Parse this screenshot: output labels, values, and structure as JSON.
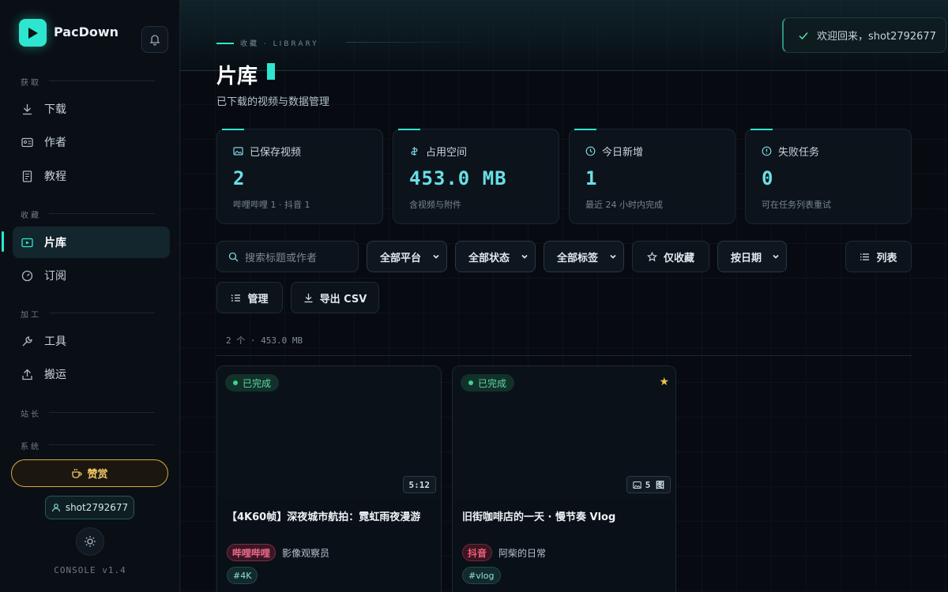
{
  "app": {
    "name": "PacDown",
    "version": "CONSOLE v1.4"
  },
  "sidebar": {
    "sections": [
      {
        "label": "获取"
      },
      {
        "label": "收藏"
      },
      {
        "label": "加工"
      },
      {
        "label": "站长"
      },
      {
        "label": "系统"
      }
    ],
    "items": [
      {
        "label": "下载",
        "icon": "download-icon"
      },
      {
        "label": "作者",
        "icon": "id-card-icon"
      },
      {
        "label": "教程",
        "icon": "book-icon"
      },
      {
        "label": "片库",
        "icon": "video-icon",
        "active": true
      },
      {
        "label": "订阅",
        "icon": "gauge-icon"
      },
      {
        "label": "工具",
        "icon": "wrench-icon"
      },
      {
        "label": "搬运",
        "icon": "upload-icon"
      }
    ],
    "donate_label": "赞赏",
    "user": "shot2792677"
  },
  "header": {
    "breadcrumb": "收藏 · LIBRARY",
    "title": "片库",
    "subtitle": "已下载的视频与数据管理"
  },
  "toast": {
    "text": "欢迎回来，shot2792677"
  },
  "stats": [
    {
      "label": "已保存视频",
      "value": "2",
      "note": "哔哩哔哩 1 · 抖音 1",
      "icon": "image-icon"
    },
    {
      "label": "占用空间",
      "value": "453.0 MB",
      "note": "含视频与附件",
      "icon": "database-icon"
    },
    {
      "label": "今日新增",
      "value": "1",
      "note": "最近 24 小时内完成",
      "icon": "clock-icon"
    },
    {
      "label": "失败任务",
      "value": "0",
      "note": "可在任务列表重试",
      "icon": "alert-icon"
    }
  ],
  "filters": {
    "search_placeholder": "搜索标题或作者",
    "platform": "全部平台",
    "status": "全部状态",
    "tag": "全部标签",
    "favorites_only": "仅收藏",
    "sort": "按日期",
    "view": "列表",
    "manage": "管理",
    "export": "导出 CSV"
  },
  "summary": "2 个 · 453.0 MB",
  "cards": [
    {
      "status": "已完成",
      "duration": "5:12",
      "title": "【4K60帧】深夜城市航拍：霓虹雨夜漫游",
      "platform": "哔哩哔哩",
      "author": "影像观察员",
      "tag": "#4K",
      "starred": false
    },
    {
      "status": "已完成",
      "duration": "5 图",
      "title": "旧街咖啡店的一天 · 慢节奏 Vlog",
      "platform": "抖音",
      "author": "阿柴的日常",
      "tag": "#vlog",
      "starred": true
    }
  ],
  "colors": {
    "accent": "#2ee6cf",
    "gold": "#f1c865",
    "success": "#38d48e",
    "platform_red": "#f06b8c"
  }
}
